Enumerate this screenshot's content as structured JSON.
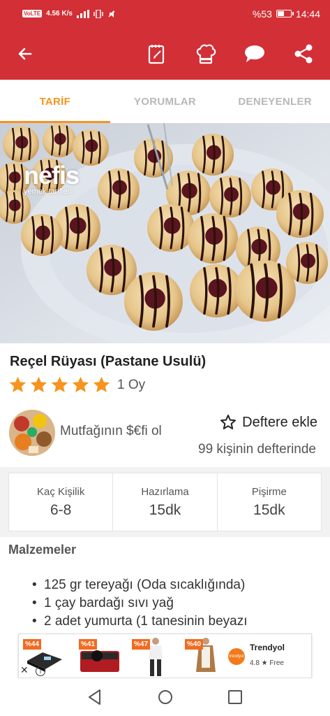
{
  "status_bar": {
    "network": "VoLTE",
    "speed": "4.56 K/s",
    "battery_percent": "%53",
    "battery_level": 0.53,
    "time": "14:44"
  },
  "app_bar": {
    "back_icon": "arrow-left-icon",
    "actions": [
      "notebook-icon",
      "chef-hat-icon",
      "comment-icon",
      "share-icon"
    ]
  },
  "tabs": [
    {
      "label": "TARİF",
      "active": true
    },
    {
      "label": "YORUMLAR",
      "active": false
    },
    {
      "label": "DENEYENLER",
      "active": false
    }
  ],
  "hero": {
    "watermark_brand": "nefis",
    "watermark_sub": "yemek tarifleri"
  },
  "recipe": {
    "title": "Reçel Rüyası (Pastane Usulü)",
    "stars": 5,
    "rating_count": "1 Oy"
  },
  "author": {
    "name": "Mutfağının $€fi ol",
    "save_label": "Deftere ekle",
    "saved_count": "99 kişinin defterinde"
  },
  "info": [
    {
      "label": "Kaç Kişilik",
      "value": "6-8"
    },
    {
      "label": "Hazırlama",
      "value": "15dk"
    },
    {
      "label": "Pişirme",
      "value": "15dk"
    }
  ],
  "ingredients": {
    "heading": "Malzemeler",
    "items": [
      "125 gr tereyağı (Oda sıcaklığında)",
      "1 çay bardağı sıvı yağ",
      "2 adet yumurta (1 tanesinin beyazı"
    ]
  },
  "ad": {
    "products": [
      {
        "discount": "%44"
      },
      {
        "discount": "%41"
      },
      {
        "discount": "%47"
      },
      {
        "discount": "%40"
      }
    ],
    "brand": "Trendyol",
    "brand_logo_text": "trendyol",
    "rating_meta": "4.8 ★ Free",
    "close_label": "✕",
    "info_label": "i"
  },
  "colors": {
    "primary": "#d22f36",
    "accent": "#f7931e",
    "star": "#f7931e"
  }
}
